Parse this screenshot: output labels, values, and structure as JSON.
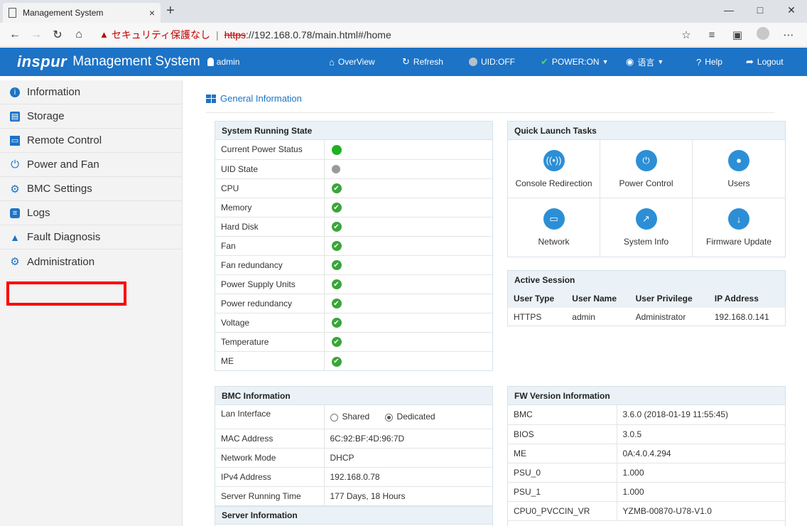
{
  "browser": {
    "tab_title": "Management System",
    "tab_close": "×",
    "new_tab": "+",
    "security_label": "セキュリティ保護なし",
    "url_https": "https",
    "url_rest": "://192.168.0.78/main.html#/home"
  },
  "app": {
    "brand": "inspur",
    "title": "Management System",
    "user": "admin"
  },
  "topnav": {
    "overview": "OverView",
    "refresh": "Refresh",
    "uid": "UID:OFF",
    "power": "POWER:ON",
    "language": "语言",
    "help": "Help",
    "logout": "Logout"
  },
  "sidebar": {
    "items": [
      {
        "label": "Information",
        "icon": "info-icon",
        "color": "#1d73c6"
      },
      {
        "label": "Storage",
        "icon": "storage-icon",
        "color": "#1d73c6"
      },
      {
        "label": "Remote Control",
        "icon": "monitor-icon",
        "color": "#1d73c6"
      },
      {
        "label": "Power and Fan",
        "icon": "power-icon",
        "color": "#1d73c6"
      },
      {
        "label": "BMC Settings",
        "icon": "gear-icon",
        "color": "#1d73c6"
      },
      {
        "label": "Logs",
        "icon": "logs-icon",
        "color": "#1d73c6"
      },
      {
        "label": "Fault Diagnosis",
        "icon": "warning-icon",
        "color": "#1d73c6"
      },
      {
        "label": "Administration",
        "icon": "admin-icon",
        "color": "#1d73c6"
      }
    ]
  },
  "main": {
    "section_title": "General Information",
    "running_state": {
      "title": "System Running State",
      "rows": [
        {
          "label": "Current Power Status",
          "status": "green-dot"
        },
        {
          "label": "UID State",
          "status": "gray-dot"
        },
        {
          "label": "CPU",
          "status": "ok"
        },
        {
          "label": "Memory",
          "status": "ok"
        },
        {
          "label": "Hard Disk",
          "status": "ok"
        },
        {
          "label": "Fan",
          "status": "ok"
        },
        {
          "label": "Fan redundancy",
          "status": "ok"
        },
        {
          "label": "Power Supply Units",
          "status": "ok"
        },
        {
          "label": "Power redundancy",
          "status": "ok"
        },
        {
          "label": "Voltage",
          "status": "ok"
        },
        {
          "label": "Temperature",
          "status": "ok"
        },
        {
          "label": "ME",
          "status": "ok"
        }
      ]
    },
    "quick_launch": {
      "title": "Quick Launch Tasks",
      "items": [
        {
          "label": "Console Redirection",
          "icon": "console-icon"
        },
        {
          "label": "Power Control",
          "icon": "power-icon"
        },
        {
          "label": "Users",
          "icon": "user-icon"
        },
        {
          "label": "Network",
          "icon": "monitor-icon"
        },
        {
          "label": "System Info",
          "icon": "chart-icon"
        },
        {
          "label": "Firmware Update",
          "icon": "download-icon"
        }
      ]
    },
    "active_session": {
      "title": "Active Session",
      "headers": [
        "User Type",
        "User Name",
        "User Privilege",
        "IP Address"
      ],
      "rows": [
        [
          "HTTPS",
          "admin",
          "Administrator",
          "192.168.0.141"
        ]
      ]
    },
    "bmc_info": {
      "title": "BMC Information",
      "lan_label": "Lan Interface",
      "lan_opt1": "Shared",
      "lan_opt2": "Dedicated",
      "rows": [
        {
          "label": "MAC Address",
          "value": "6C:92:BF:4D:96:7D"
        },
        {
          "label": "Network Mode",
          "value": "DHCP"
        },
        {
          "label": "IPv4 Address",
          "value": "192.168.0.78"
        },
        {
          "label": "Server Running Time",
          "value": "177 Days, 18 Hours"
        }
      ],
      "server_info_title": "Server Information"
    },
    "fw_version": {
      "title": "FW Version Information",
      "rows": [
        {
          "label": "BMC",
          "value": "3.6.0 (2018-01-19 11:55:45)"
        },
        {
          "label": "BIOS",
          "value": "3.0.5"
        },
        {
          "label": "ME",
          "value": "0A:4.0.4.294"
        },
        {
          "label": "PSU_0",
          "value": "1.000"
        },
        {
          "label": "PSU_1",
          "value": "1.000"
        },
        {
          "label": "CPU0_PVCCIN_VR",
          "value": "YZMB-00870-U78-V1.0"
        }
      ]
    }
  }
}
